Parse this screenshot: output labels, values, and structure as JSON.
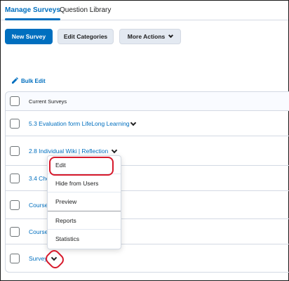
{
  "tabs": [
    {
      "label": "Manage Surveys",
      "active": true
    },
    {
      "label": "Question Library",
      "active": false
    }
  ],
  "toolbar": {
    "new_survey_label": "New Survey",
    "edit_categories_label": "Edit Categories",
    "more_actions_label": "More Actions"
  },
  "bulk_edit_label": "Bulk Edit",
  "table": {
    "header": "Current Surveys",
    "rows": [
      {
        "label": "5.3 Evaluation form LifeLong Learning"
      },
      {
        "label": "2.8 Individual Wiki | Reflection"
      },
      {
        "label": "3.4 Cho"
      },
      {
        "label": "Course"
      },
      {
        "label": "Course"
      },
      {
        "label": "Survey"
      }
    ]
  },
  "context_menu": {
    "items": [
      "Edit",
      "Hide from Users",
      "Preview",
      "Reports",
      "Statistics"
    ]
  },
  "colors": {
    "accent": "#006fbf",
    "highlight": "#d7192b",
    "button_secondary": "#e3e9f1"
  }
}
